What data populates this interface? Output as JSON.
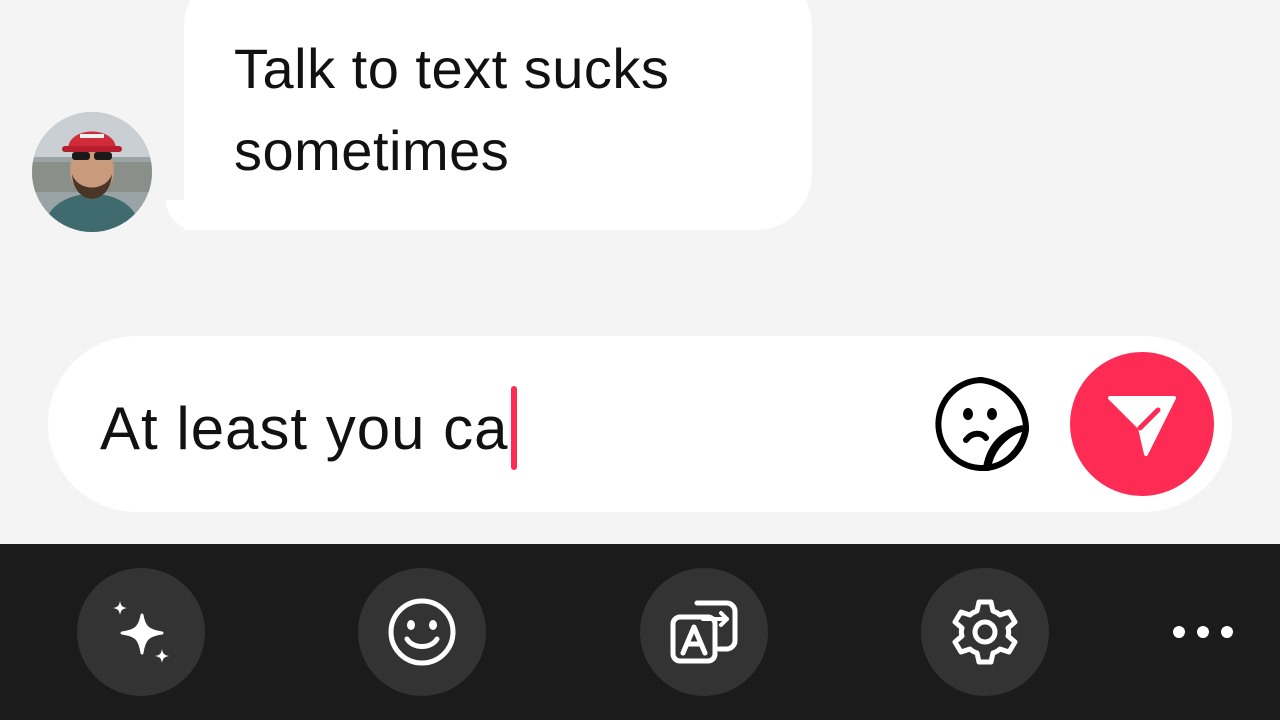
{
  "message": {
    "text": "Talk to text sucks sometimes",
    "avatar_icon": "user-avatar"
  },
  "composer": {
    "value": "At least you ca",
    "sticker_icon": "sticker-icon",
    "send_icon": "send-icon",
    "accent_color": "#fe2c55"
  },
  "toolbar": {
    "items": [
      {
        "icon": "sparkles-icon"
      },
      {
        "icon": "emoji-icon"
      },
      {
        "icon": "translate-icon"
      },
      {
        "icon": "gear-icon"
      },
      {
        "icon": "more-icon"
      }
    ],
    "background": "#1b1b1b"
  }
}
